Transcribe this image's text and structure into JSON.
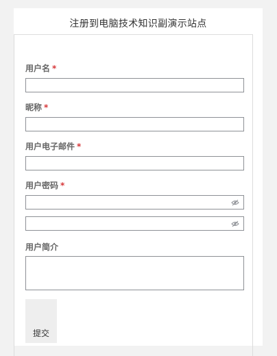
{
  "title": "注册到电脑技术知识副演示站点",
  "form": {
    "required_mark": "*",
    "username": {
      "label": "用户名",
      "value": ""
    },
    "nickname": {
      "label": "昵称",
      "value": ""
    },
    "email": {
      "label": "用户电子邮件",
      "value": ""
    },
    "password": {
      "label": "用户密码",
      "value": "",
      "confirm_value": "",
      "toggle_icon": "eye-slash-icon"
    },
    "bio": {
      "label": "用户简介",
      "value": ""
    },
    "submit_label": "提交"
  },
  "colors": {
    "background": "#f2f2f2",
    "card": "#ffffff",
    "required": "#d63638",
    "label": "#666666",
    "border": "#8c8f94"
  }
}
